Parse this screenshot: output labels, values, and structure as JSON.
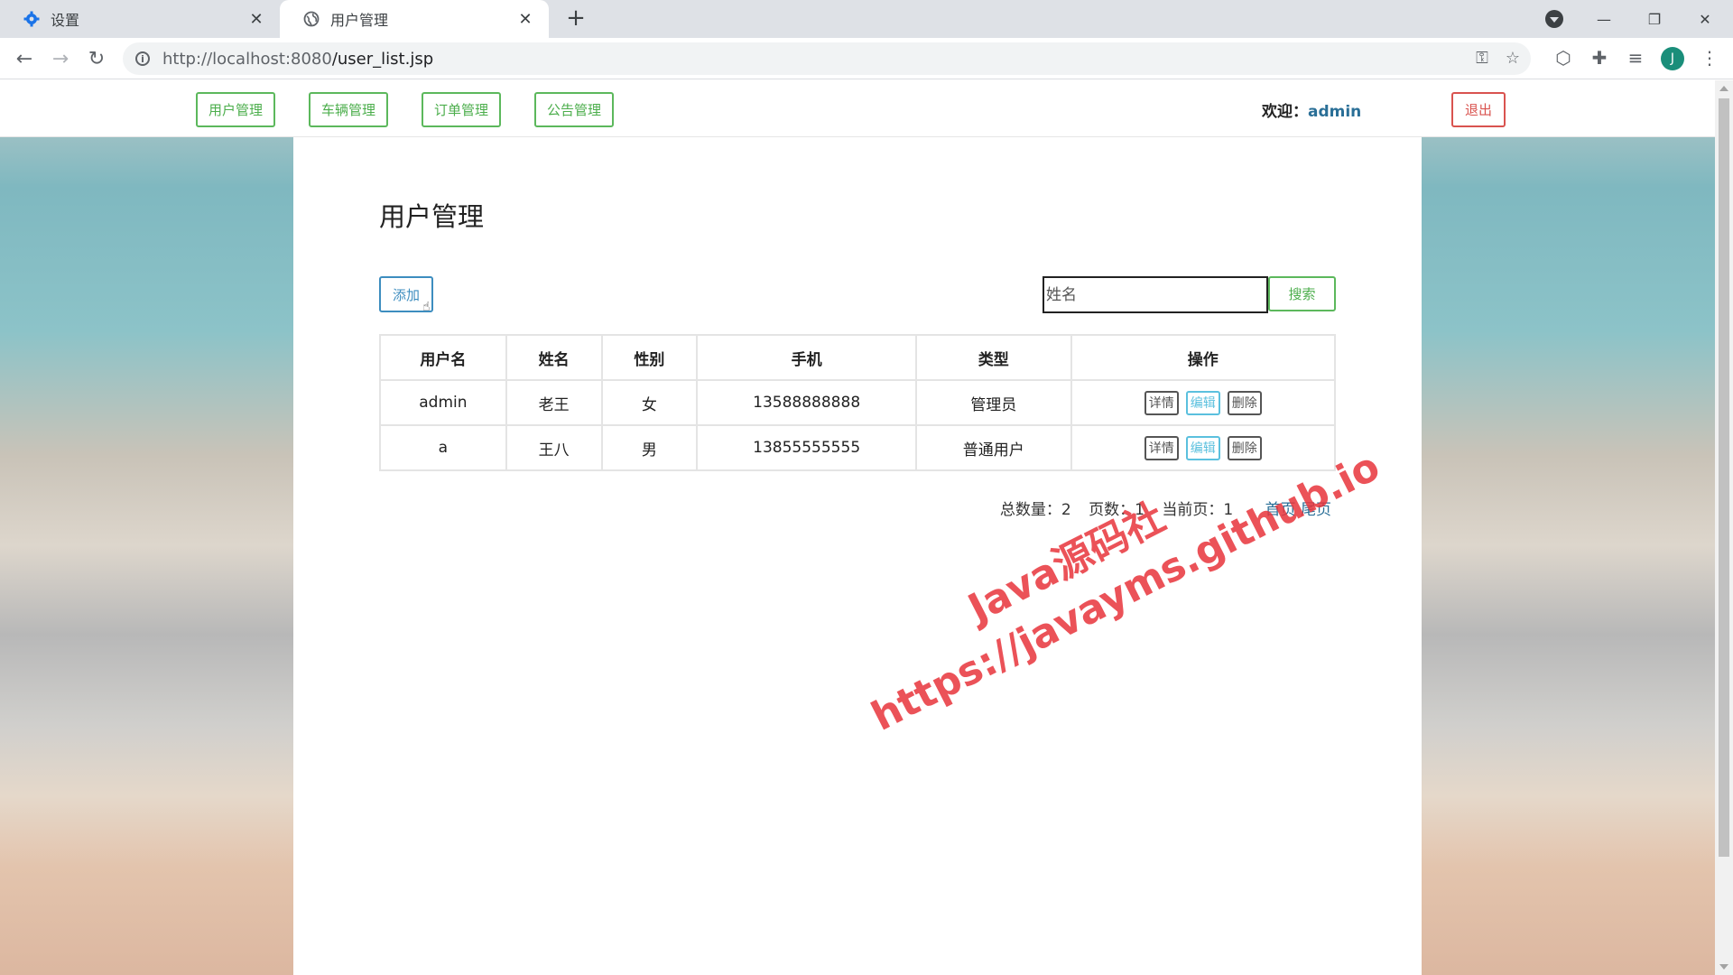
{
  "browser": {
    "tabs": [
      {
        "title": "设置",
        "icon": "gear-icon"
      },
      {
        "title": "用户管理",
        "icon": "globe-icon"
      }
    ],
    "url_host": "http://localhost:8080",
    "url_path": "/user_list.jsp",
    "avatar_letter": "J"
  },
  "topnav": {
    "items": [
      "用户管理",
      "车辆管理",
      "订单管理",
      "公告管理"
    ],
    "welcome_label": "欢迎：",
    "username": "admin",
    "logout_label": "退出"
  },
  "main": {
    "title": "用户管理",
    "add_label": "添加",
    "search_placeholder": "姓名",
    "search_label": "搜索",
    "table": {
      "headers": [
        "用户名",
        "姓名",
        "性别",
        "手机",
        "类型",
        "操作"
      ],
      "rows": [
        {
          "username": "admin",
          "name": "老王",
          "gender": "女",
          "phone": "13588888888",
          "type": "管理员"
        },
        {
          "username": "a",
          "name": "王八",
          "gender": "男",
          "phone": "13855555555",
          "type": "普通用户"
        }
      ],
      "actions": [
        "详情",
        "编辑",
        "删除"
      ]
    },
    "pager": {
      "total_label": "总数量：",
      "total": "2",
      "pages_label": "页数：",
      "pages": "1",
      "current_label": "当前页：",
      "current": "1",
      "first_label": "首页",
      "last_label": "尾页"
    }
  },
  "watermark": {
    "line1": "Java源码社",
    "line2": "https://javayms.github.io"
  },
  "colors": {
    "success": "#5cb85c",
    "danger": "#d9534f",
    "primary": "#3d8dbf",
    "info": "#5bc0de",
    "watermark": "#e8343c"
  }
}
